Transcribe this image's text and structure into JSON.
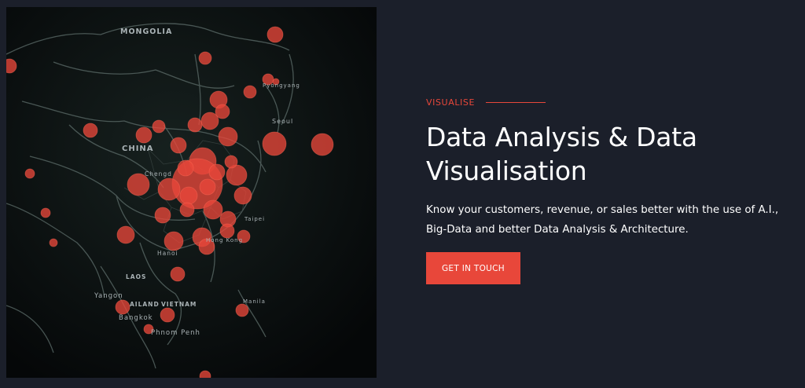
{
  "section": {
    "eyebrow": "VISUALISE",
    "title": "Data Analysis & Data Visualisation",
    "description": "Know your customers, revenue, or sales better with the use of A.I., Big-Data and better Data Analysis & Architecture.",
    "cta_label": "GET IN TOUCH"
  },
  "map": {
    "labels": [
      "MONGOLIA",
      "CHINA",
      "Chengd",
      "Hanoi",
      "LAOS",
      "Yangon",
      "AILAND",
      "VIETNAM",
      "Bangkok",
      "Phnom Penh",
      "Hong Kong",
      "Taipei",
      "Manila",
      "Pyongyang",
      "Seoul"
    ],
    "marker_color": "#e8473a"
  },
  "colors": {
    "background": "#1b1f2a",
    "accent": "#e8473a",
    "text": "#ffffff"
  }
}
